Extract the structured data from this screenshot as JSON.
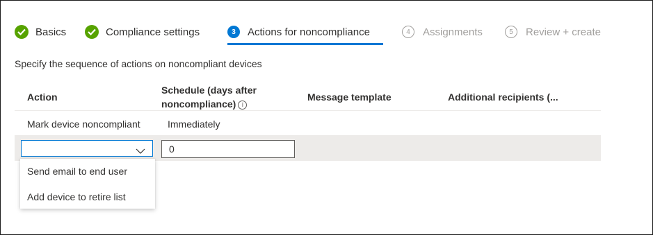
{
  "wizard": {
    "steps": [
      {
        "label": "Basics",
        "status": "complete",
        "icon": "checkmark-circle-icon"
      },
      {
        "label": "Compliance settings",
        "status": "complete",
        "icon": "checkmark-circle-icon"
      },
      {
        "label": "Actions for noncompliance",
        "status": "active",
        "number": "3"
      },
      {
        "label": "Assignments",
        "status": "pending",
        "number": "4"
      },
      {
        "label": "Review + create",
        "status": "pending",
        "number": "5"
      }
    ]
  },
  "description": "Specify the sequence of actions on noncompliant devices",
  "table": {
    "headers": {
      "action": "Action",
      "schedule_line1": "Schedule (days after",
      "schedule_line2": "noncompliance)",
      "message_template": "Message template",
      "additional_recipients": "Additional recipients (..."
    },
    "rows": [
      {
        "action": "Mark device noncompliant",
        "schedule": "Immediately"
      }
    ],
    "edit_row": {
      "action_value": "",
      "schedule_value": "0"
    }
  },
  "dropdown": {
    "options": [
      "Send email to end user",
      "Add device to retire list"
    ]
  },
  "colors": {
    "accent": "#0078d4",
    "complete": "#57a300",
    "inactive": "#a19f9d"
  }
}
